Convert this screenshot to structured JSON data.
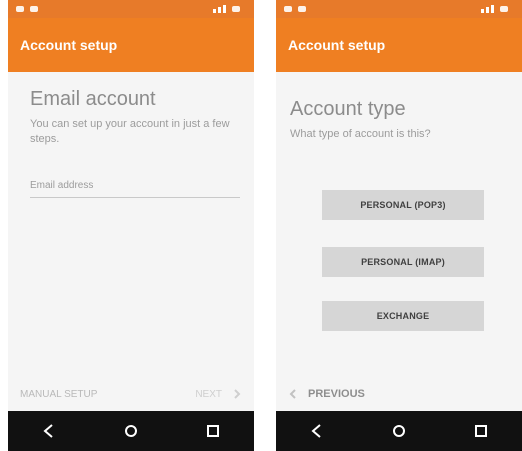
{
  "left_screen": {
    "app_bar_title": "Account setup",
    "title": "Email account",
    "subtitle": "You can set up your account in just a few steps.",
    "email_label": "Email address",
    "manual_setup": "MANUAL SETUP",
    "next": "NEXT",
    "next_icon": "chevron-right-icon"
  },
  "right_screen": {
    "app_bar_title": "Account setup",
    "title": "Account type",
    "subtitle": "What type of account is this?",
    "buttons": [
      "PERSONAL (POP3)",
      "PERSONAL (IMAP)",
      "EXCHANGE"
    ],
    "previous": "PREVIOUS",
    "previous_icon": "chevron-left-icon"
  },
  "navbar_icons": [
    "back-icon",
    "home-icon",
    "recents-icon"
  ],
  "colors": {
    "accent": "#ef7f22",
    "statusbar": "#e77a2a",
    "navbar": "#111111"
  }
}
